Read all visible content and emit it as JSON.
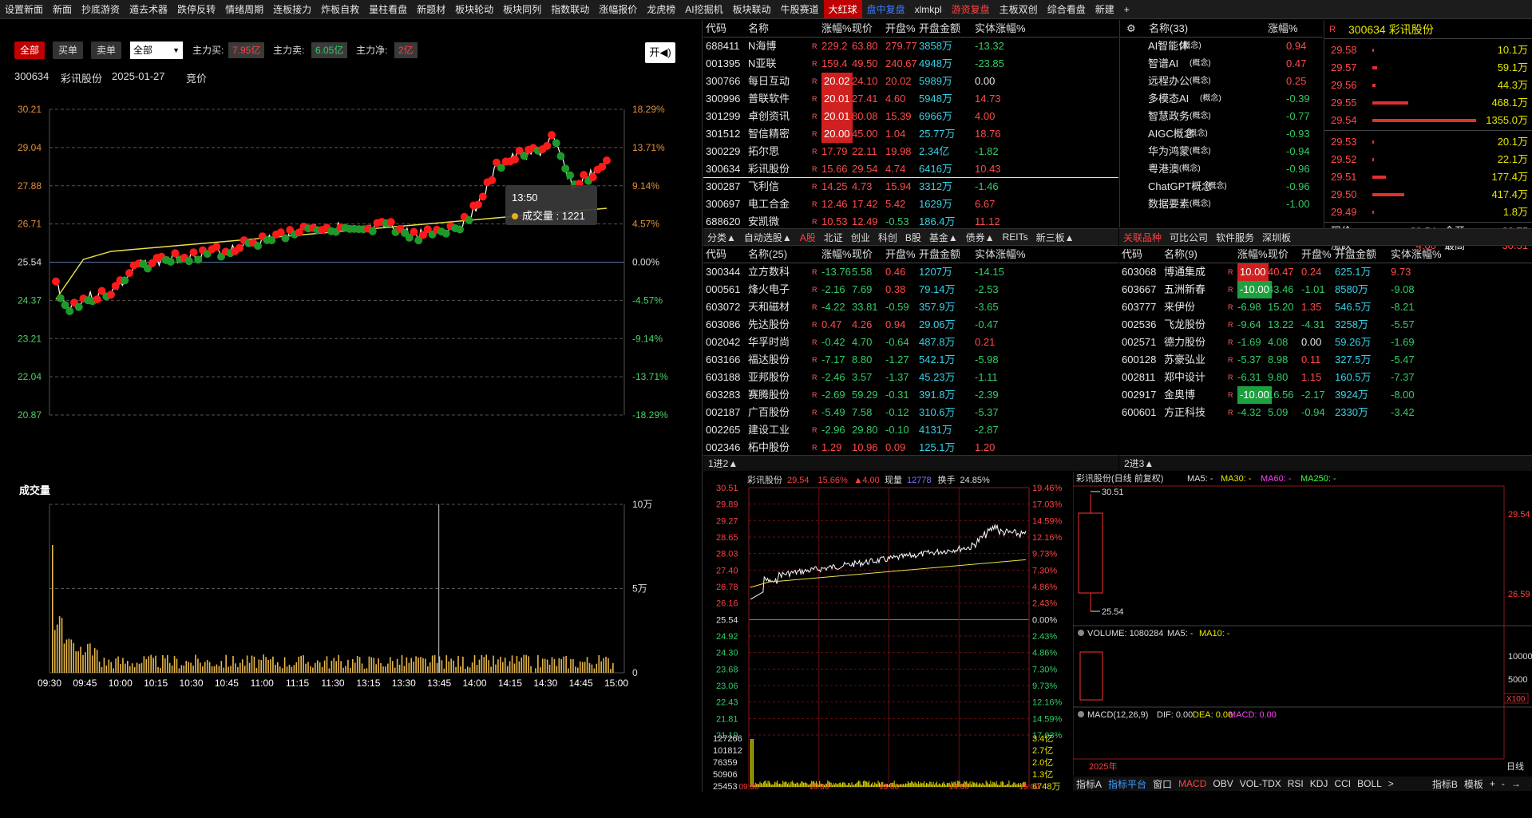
{
  "menu": [
    "设置新面",
    "新面",
    "抄底游资",
    "遁去术器",
    "跌停反转",
    "情绪周期",
    "连板接力",
    "炸板自救",
    "量柱看盘",
    "新题材",
    "板块轮动",
    "板块同列",
    "指数联动",
    "涨幅报价",
    "龙虎榜",
    "AI挖掘机",
    "板块联动",
    "牛股赛道",
    "大红球",
    "盘中复盘",
    "xlmkpl",
    "游资复盘",
    "主板双创",
    "综合看盘",
    "新建",
    "+"
  ],
  "menu_hot": "大红球",
  "filter": {
    "all": "全部",
    "buy": "买单",
    "sell": "卖单",
    "select": "全部",
    "main_buy_label": "主力买:",
    "main_buy": "7.95亿",
    "main_sell_label": "主力卖:",
    "main_sell": "6.05亿",
    "main_net_label": "主力净:",
    "main_net": "2亿",
    "switch": "开◀)"
  },
  "stock_info": {
    "code": "300634",
    "name": "彩讯股份",
    "date": "2025-01-27",
    "mode": "竞价"
  },
  "intraday": {
    "y_left": [
      "30.21",
      "29.04",
      "27.88",
      "26.71",
      "25.54",
      "24.37",
      "23.21",
      "22.04",
      "20.87"
    ],
    "y_right": [
      "18.29%",
      "13.71%",
      "9.14%",
      "4.57%",
      "0.00%",
      "-4.57%",
      "-9.14%",
      "-13.71%",
      "-18.29%"
    ],
    "tooltip_time": "13:50",
    "tooltip_label": "成交量 : 1221",
    "volume_title": "成交量",
    "vol_right": [
      "10万",
      "5万",
      "0"
    ],
    "x_labels": [
      "09:30",
      "09:45",
      "10:00",
      "10:15",
      "10:30",
      "10:45",
      "11:00",
      "11:15",
      "11:30",
      "13:15",
      "13:30",
      "13:45",
      "14:00",
      "14:15",
      "14:30",
      "14:45",
      "15:00"
    ]
  },
  "top_table": {
    "headers": [
      "代码",
      "名称",
      "涨幅%",
      "现价",
      "开盘%",
      "开盘金额",
      "实体涨幅%"
    ],
    "rows": [
      [
        "688411",
        "N海博",
        "229.2",
        "63.80",
        "279.77",
        "3858万",
        "-13.32"
      ],
      [
        "001395",
        "N亚联",
        "159.4",
        "49.50",
        "240.67",
        "4948万",
        "-23.85"
      ],
      [
        "300766",
        "每日互动",
        "20.02",
        "24.10",
        "20.02",
        "5989万",
        "0.00"
      ],
      [
        "300996",
        "普联软件",
        "20.01",
        "27.41",
        "4.60",
        "5948万",
        "14.73"
      ],
      [
        "301299",
        "卓创资讯",
        "20.01",
        "80.08",
        "15.39",
        "6966万",
        "4.00"
      ],
      [
        "301512",
        "智信精密",
        "20.00",
        "45.00",
        "1.04",
        "25.77万",
        "18.76"
      ],
      [
        "300229",
        "拓尔思",
        "17.79",
        "22.11",
        "19.98",
        "2.34亿",
        "-1.82"
      ],
      [
        "300634",
        "彩讯股份",
        "15.66",
        "29.54",
        "4.74",
        "6416万",
        "10.43"
      ],
      [
        "300287",
        "飞利信",
        "14.25",
        "4.73",
        "15.94",
        "3312万",
        "-1.46"
      ],
      [
        "300697",
        "电工合金",
        "12.46",
        "17.42",
        "5.42",
        "1629万",
        "6.67"
      ],
      [
        "688620",
        "安凯微",
        "10.53",
        "12.49",
        "-0.53",
        "186.4万",
        "11.12"
      ]
    ]
  },
  "mid_tabs": [
    "分类▲",
    "自动选股▲",
    "A股",
    "北证",
    "创业",
    "科创",
    "B股",
    "基金▲",
    "债券▲",
    "REITs",
    "新三板▲"
  ],
  "mid_table": {
    "headers": [
      "代码",
      "名称(25)",
      "涨幅%",
      "现价",
      "开盘%",
      "开盘金额",
      "实体涨幅%"
    ],
    "rows": [
      [
        "300344",
        "立方数科",
        "-13.76",
        "5.58",
        "0.46",
        "1207万",
        "-14.15"
      ],
      [
        "000561",
        "烽火电子",
        "-2.16",
        "7.69",
        "0.38",
        "79.14万",
        "-2.53"
      ],
      [
        "603072",
        "天和磁材",
        "-4.22",
        "33.81",
        "-0.59",
        "357.9万",
        "-3.65"
      ],
      [
        "603086",
        "先达股份",
        "0.47",
        "4.26",
        "0.94",
        "29.06万",
        "-0.47"
      ],
      [
        "002042",
        "华孚时尚",
        "-0.42",
        "4.70",
        "-0.64",
        "487.8万",
        "0.21"
      ],
      [
        "603166",
        "福达股份",
        "-7.17",
        "8.80",
        "-1.27",
        "542.1万",
        "-5.98"
      ],
      [
        "603188",
        "亚邦股份",
        "-2.46",
        "3.57",
        "-1.37",
        "45.23万",
        "-1.11"
      ],
      [
        "603283",
        "赛腾股份",
        "-2.69",
        "59.29",
        "-0.31",
        "391.8万",
        "-2.39"
      ],
      [
        "002187",
        "广百股份",
        "-5.49",
        "7.58",
        "-0.12",
        "310.6万",
        "-5.37"
      ],
      [
        "002265",
        "建设工业",
        "-2.96",
        "29.80",
        "-0.10",
        "4131万",
        "-2.87"
      ],
      [
        "002346",
        "柘中股份",
        "1.29",
        "10.96",
        "0.09",
        "125.1万",
        "1.20"
      ]
    ],
    "footer": "1进2▲"
  },
  "concepts": {
    "header_name": "名称(33)",
    "header_chg": "涨幅%",
    "rows": [
      [
        "AI智能体",
        "(概念)",
        "0.94"
      ],
      [
        "智谱AI",
        "(概念)",
        "0.47"
      ],
      [
        "远程办公",
        "(概念)",
        "0.25"
      ],
      [
        "多模态AI",
        "(概念)",
        "-0.39"
      ],
      [
        "智慧政务",
        "(概念)",
        "-0.77"
      ],
      [
        "AIGC概念",
        "(概念)",
        "-0.93"
      ],
      [
        "华为鸿蒙",
        "(概念)",
        "-0.94"
      ],
      [
        "粤港澳",
        "(概念)",
        "-0.96"
      ],
      [
        "ChatGPT概念",
        "(概念)",
        "-0.96"
      ],
      [
        "数据要素",
        "(概念)",
        "-1.00"
      ]
    ]
  },
  "rel_tabs": [
    "关联品种",
    "可比公司",
    "软件服务",
    "深圳板"
  ],
  "rel_table": {
    "headers": [
      "代码",
      "名称(9)",
      "涨幅%",
      "现价",
      "开盘%",
      "开盘金额",
      "实体涨幅%"
    ],
    "rows": [
      [
        "603068",
        "博通集成",
        "10.00",
        "40.47",
        "0.24",
        "625.1万",
        "9.73"
      ],
      [
        "603667",
        "五洲新春",
        "-10.00",
        "43.46",
        "-1.01",
        "8580万",
        "-9.08"
      ],
      [
        "603777",
        "来伊份",
        "-6.98",
        "15.20",
        "1.35",
        "546.5万",
        "-8.21"
      ],
      [
        "002536",
        "飞龙股份",
        "-9.64",
        "13.22",
        "-4.31",
        "3258万",
        "-5.57"
      ],
      [
        "002571",
        "德力股份",
        "-1.69",
        "4.08",
        "0.00",
        "59.26万",
        "-1.69"
      ],
      [
        "600128",
        "苏豪弘业",
        "-5.37",
        "8.98",
        "0.11",
        "327.5万",
        "-5.47"
      ],
      [
        "002811",
        "郑中设计",
        "-6.31",
        "9.80",
        "1.15",
        "160.5万",
        "-7.37"
      ],
      [
        "002917",
        "金奥博",
        "-10.00",
        "16.56",
        "-2.17",
        "3924万",
        "-8.00"
      ],
      [
        "600601",
        "方正科技",
        "-4.32",
        "5.09",
        "-0.94",
        "2330万",
        "-3.42"
      ]
    ],
    "footer": "2进3▲"
  },
  "quote": {
    "code": "300634",
    "name": "彩讯股份",
    "asks": [
      [
        "29.58",
        "10.1万"
      ],
      [
        "29.57",
        "59.1万"
      ],
      [
        "29.56",
        "44.3万"
      ],
      [
        "29.55",
        "468.1万"
      ],
      [
        "29.54",
        "1355.0万"
      ]
    ],
    "bids": [
      [
        "29.53",
        "20.1万"
      ],
      [
        "29.52",
        "22.1万"
      ],
      [
        "29.51",
        "177.4万"
      ],
      [
        "29.50",
        "417.4万"
      ],
      [
        "29.49",
        "1.8万"
      ]
    ],
    "price_label": "现价",
    "price": "29.54",
    "open_label": "今开",
    "open": "26.75",
    "chg_label": "涨跌",
    "chg": "4.00",
    "high_label": "最高",
    "high": "30.51"
  },
  "mini": {
    "title": "彩讯股份",
    "price": "29.54",
    "pct": "15.66%",
    "up": "▲4.00",
    "vol_label": "现量",
    "vol": "12778",
    "turn_label": "换手",
    "turn": "24.85%",
    "y_left": [
      "30.51",
      "29.89",
      "29.27",
      "28.65",
      "28.03",
      "27.40",
      "26.78",
      "26.16",
      "25.54",
      "24.92",
      "24.30",
      "23.68",
      "23.06",
      "22.43",
      "21.81",
      "21.19"
    ],
    "y_right": [
      "19.46%",
      "17.03%",
      "14.59%",
      "12.16%",
      "9.73%",
      "7.30%",
      "4.86%",
      "2.43%",
      "0.00%",
      "2.43%",
      "4.86%",
      "7.30%",
      "9.73%",
      "12.16%",
      "14.59%",
      "17.03%"
    ],
    "vol_left": [
      "127266",
      "101812",
      "76359",
      "50906",
      "25453"
    ],
    "vol_right": [
      "3.4亿",
      "2.7亿",
      "2.0亿",
      "1.3亿",
      "6748万"
    ],
    "x_labels": [
      "09:30",
      "10:30",
      "13:00",
      "14:00",
      "15:00"
    ]
  },
  "kline": {
    "title": "彩讯股份(日线 前复权)",
    "ma5": "MA5: -",
    "ma30": "MA30: -",
    "ma60": "MA60: -",
    "ma250": "MA250: -",
    "high": "30.51",
    "low": "25.54",
    "y_right": [
      "29.54",
      "26.59"
    ],
    "vol_title": "VOLUME: 1080284",
    "vol_ma5": "MA5: -",
    "vol_ma10": "MA10: -",
    "vol_y": [
      "10000",
      "5000"
    ],
    "vol_unit": "X100",
    "macd_title": "MACD(12,26,9)",
    "dif": "DIF: 0.00",
    "dea": "DEA: 0.00",
    "macd": "MACD: 0.00",
    "year": "2025年",
    "period": "日线"
  },
  "bottom_tabs": [
    "指标A",
    "指标平台",
    "窗口",
    "MACD",
    "OBV",
    "VOL-TDX",
    "RSI",
    "KDJ",
    "CCI",
    "BOLL",
    ">",
    "指标B",
    "模板",
    "+",
    "-",
    "→"
  ]
}
